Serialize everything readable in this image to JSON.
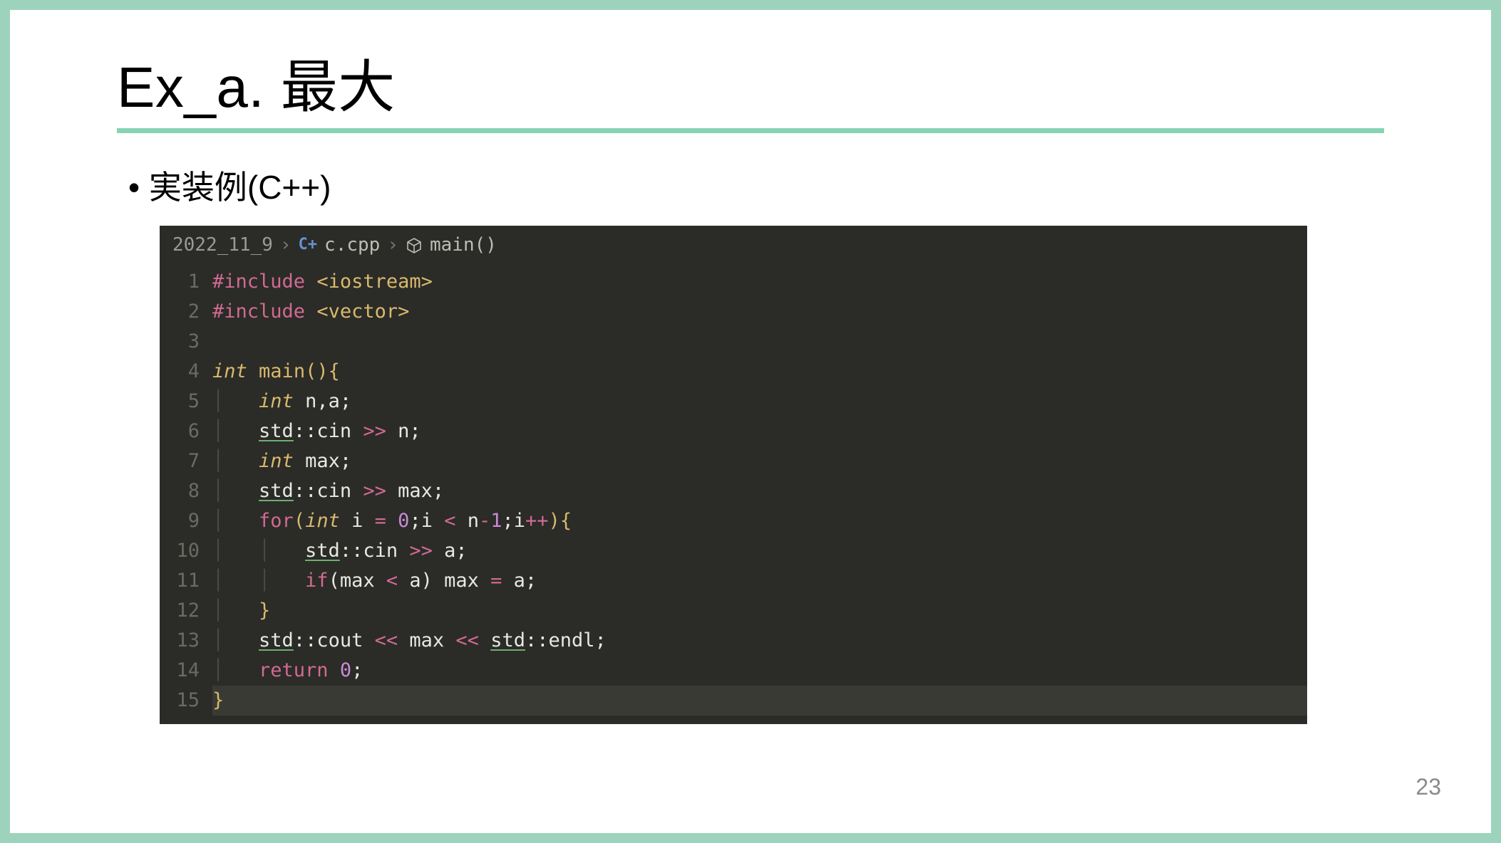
{
  "slide": {
    "title": "Ex_a. 最大",
    "bullet": "実装例(C++)",
    "page_number": "23"
  },
  "breadcrumbs": {
    "folder": "2022_11_9",
    "file": "c.cpp",
    "symbol": "main()"
  },
  "code": {
    "line_count": 15,
    "lines": {
      "l1": {
        "pp": "#include ",
        "arg": "<iostream>"
      },
      "l2": {
        "pp": "#include ",
        "arg": "<vector>"
      },
      "l3": "",
      "l4": {
        "type": "int",
        "sp": " ",
        "fn": "main",
        "rest1": "(){"
      },
      "l5": {
        "indent": "    ",
        "type": "int",
        "rest": " n,a;"
      },
      "l6": {
        "indent": "    ",
        "std": "std",
        "mid": "::cin ",
        "op": ">>",
        "tail": " n;"
      },
      "l7": {
        "indent": "    ",
        "type": "int",
        "rest": " max;"
      },
      "l8": {
        "indent": "    ",
        "std": "std",
        "mid": "::cin ",
        "op": ">>",
        "tail": " max;"
      },
      "l9": {
        "indent": "    ",
        "kw": "for",
        "p1": "(",
        "type": "int",
        "sp": " i ",
        "op1": "=",
        "sp2": " ",
        "num": "0",
        "mid1": ";i ",
        "op2": "<",
        "mid2": " n",
        "op3": "-",
        "num2": "1",
        "mid3": ";i",
        "op4": "++",
        "tail": "){"
      },
      "l10": {
        "indent": "        ",
        "std": "std",
        "mid": "::cin ",
        "op": ">>",
        "tail": " a;"
      },
      "l11": {
        "indent": "        ",
        "kw": "if",
        "p1": "(max ",
        "op1": "<",
        "mid1": " a) max ",
        "op2": "=",
        "tail": " a;"
      },
      "l12": {
        "indent": "    ",
        "brace": "}"
      },
      "l13": {
        "indent": "    ",
        "std1": "std",
        "mid1": "::cout ",
        "op1": "<<",
        "mid2": " max ",
        "op2": "<<",
        "sp": " ",
        "std2": "std",
        "tail": "::endl;"
      },
      "l14": {
        "indent": "    ",
        "kw": "return",
        "sp": " ",
        "num": "0",
        "tail": ";"
      },
      "l15": {
        "brace": "}"
      }
    }
  }
}
